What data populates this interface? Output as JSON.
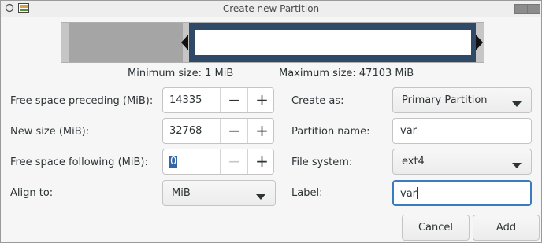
{
  "window": {
    "title": "Create new Partition"
  },
  "partition_map": {
    "free_preceding_mib": 14335,
    "new_size_mib": 32768,
    "free_following_mib": 0,
    "colors": {
      "free": "#a5a5a5",
      "partition": "#2e4a66",
      "unallocated": "#c6c6c6"
    }
  },
  "size_info": {
    "minimum": "Minimum size: 1 MiB",
    "maximum": "Maximum size: 47103 MiB"
  },
  "fields": {
    "free_preceding": {
      "label": "Free space preceding (MiB):",
      "value": "14335"
    },
    "new_size": {
      "label": "New size (MiB):",
      "value": "32768"
    },
    "free_following": {
      "label": "Free space following (MiB):",
      "value": "0"
    },
    "align_to": {
      "label": "Align to:",
      "value": "MiB"
    },
    "create_as": {
      "label": "Create as:",
      "value": "Primary Partition"
    },
    "partition_name": {
      "label": "Partition name:",
      "value": "var"
    },
    "file_system": {
      "label": "File system:",
      "value": "ext4"
    },
    "fs_label": {
      "label": "Label:",
      "value": "var"
    }
  },
  "buttons": {
    "cancel": "Cancel",
    "add": "Add"
  },
  "icons": {
    "app": "gparted-icon",
    "close": "close-icon",
    "minimize": "minimize-icon",
    "maximize": "maximize-icon",
    "minus": "minus-icon",
    "plus": "plus-icon",
    "dropdown": "chevron-down-icon"
  }
}
